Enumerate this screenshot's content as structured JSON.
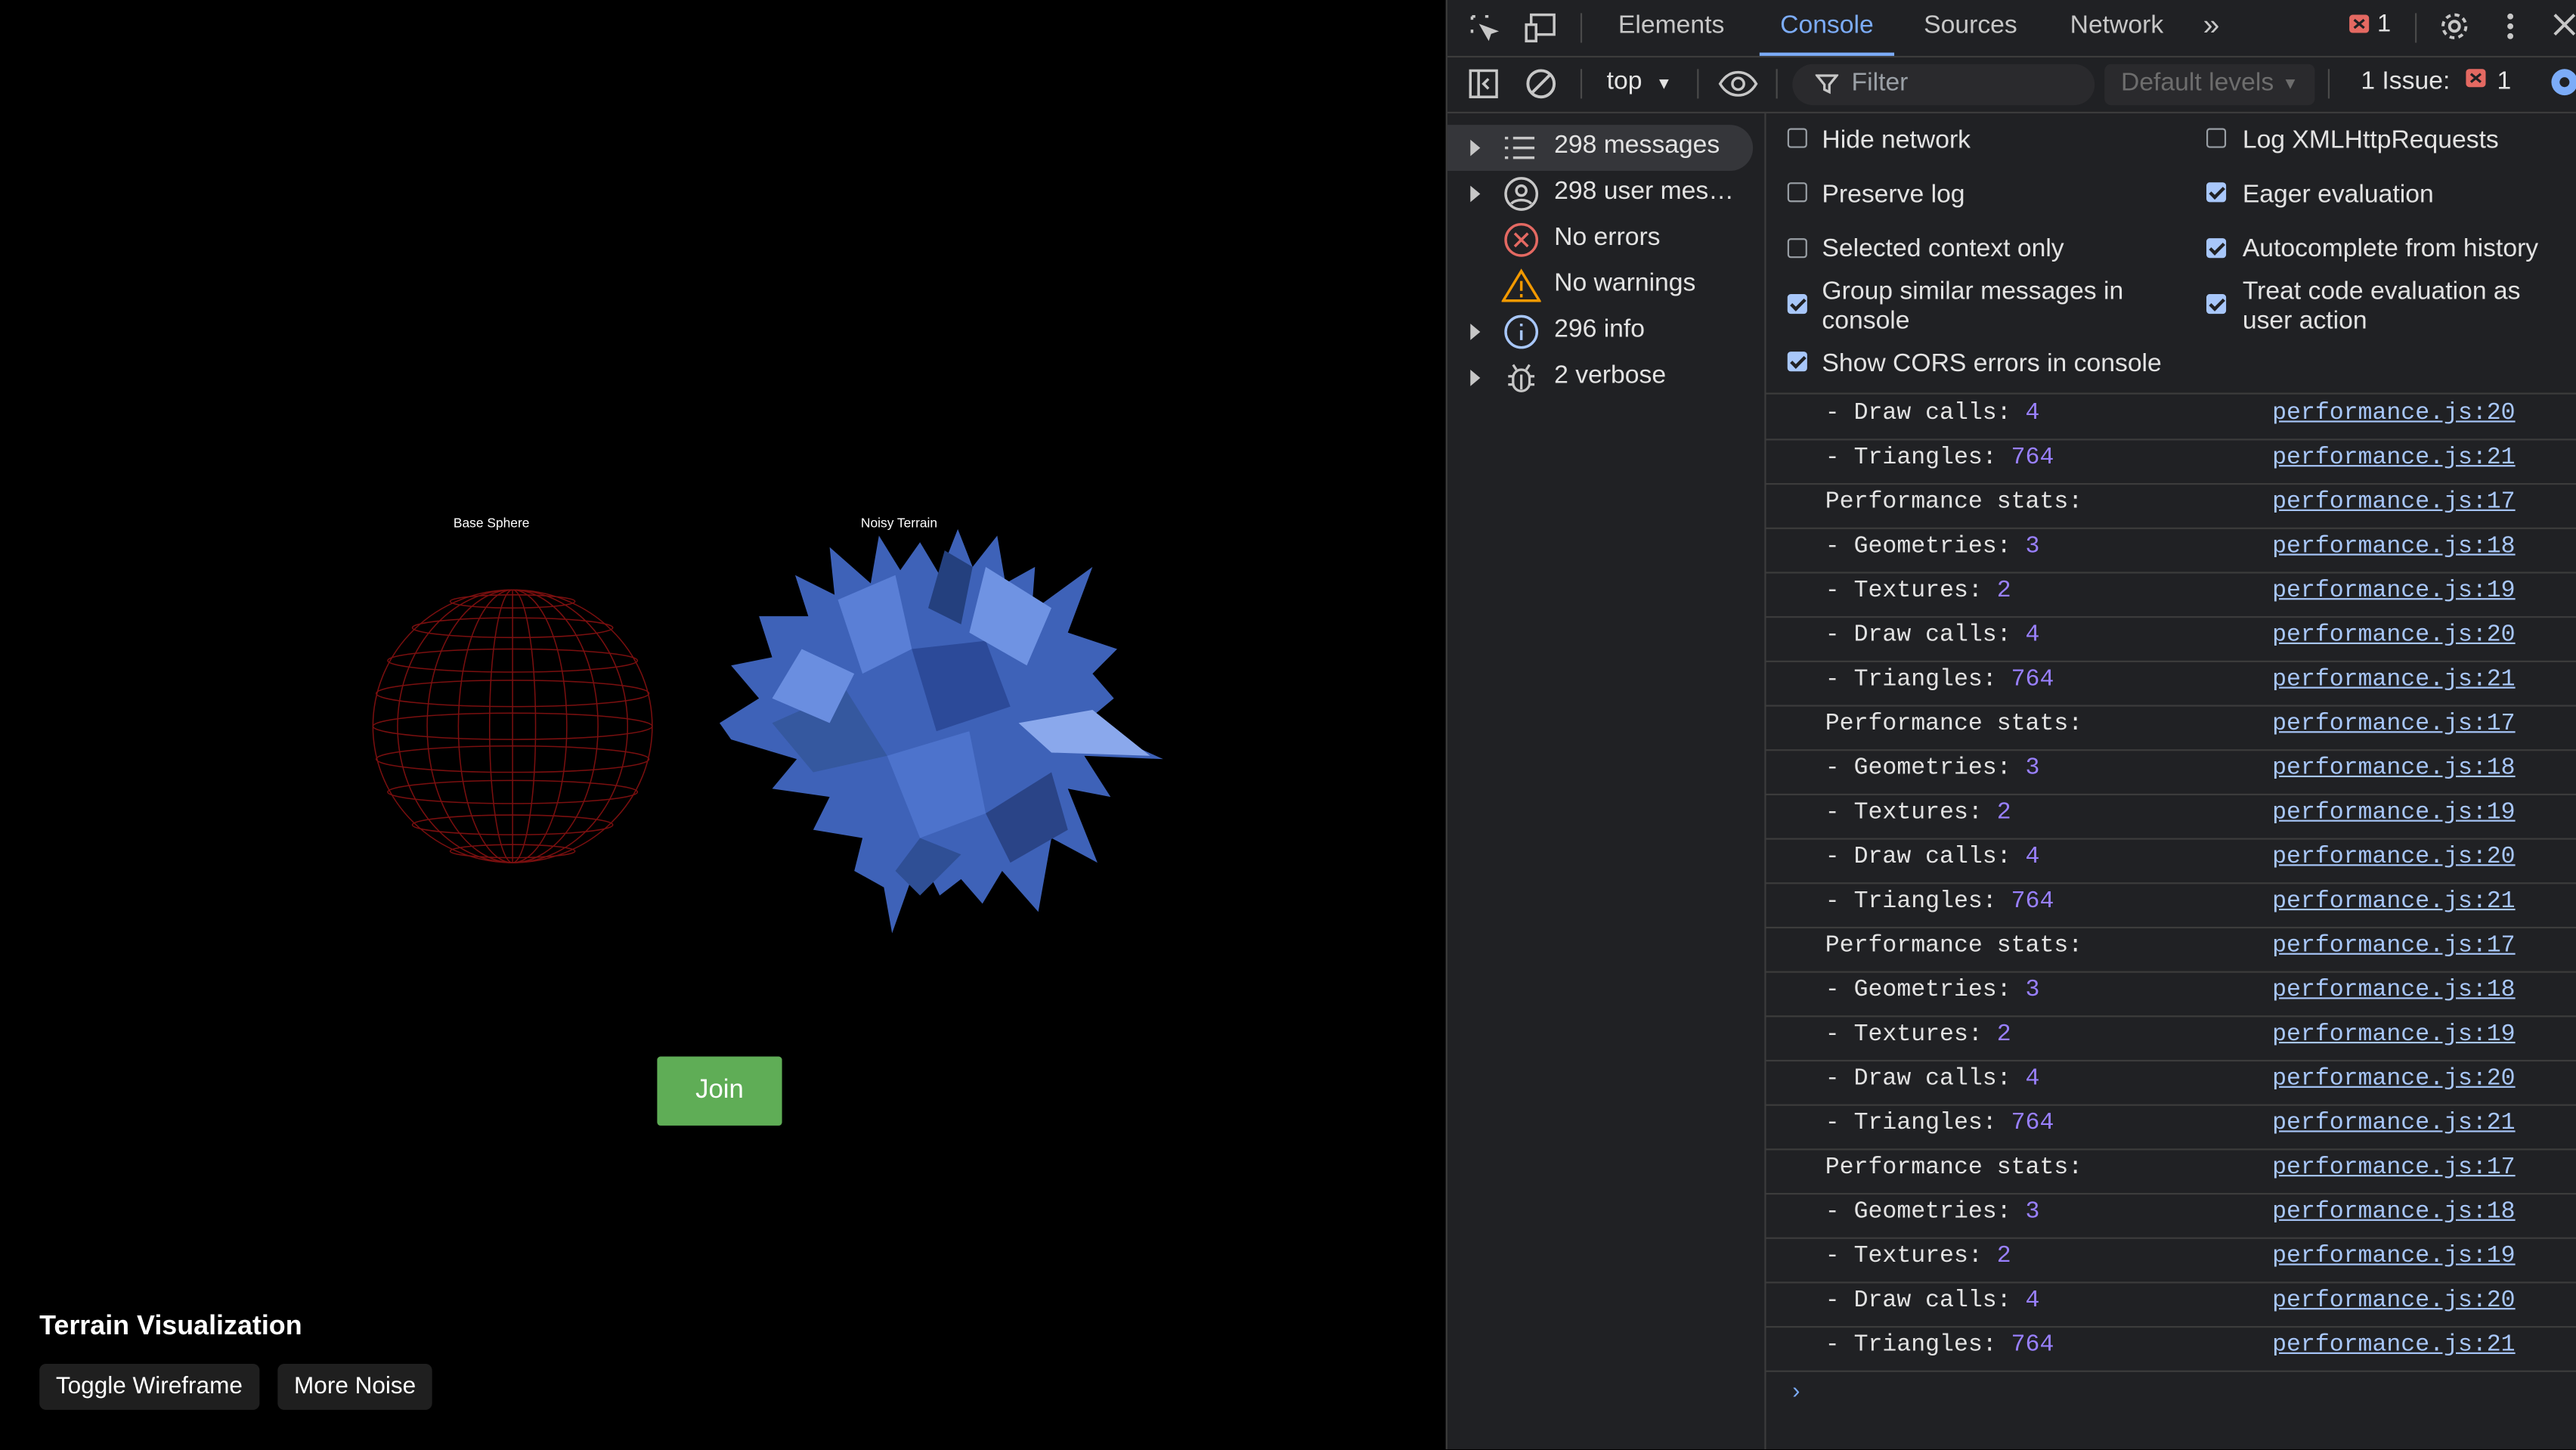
{
  "page": {
    "labels": {
      "sphere": "Base Sphere",
      "terrain": "Noisy Terrain"
    },
    "join_label": "Join",
    "title": "Terrain Visualization",
    "buttons": {
      "wireframe": "Toggle Wireframe",
      "noise": "More Noise"
    }
  },
  "devtools": {
    "tabs": [
      "Elements",
      "Console",
      "Sources",
      "Network"
    ],
    "active_tab": "Console",
    "error_badge_count": "1",
    "context": "top",
    "filter_placeholder": "Filter",
    "levels": "Default levels",
    "issues_label": "1 Issue:",
    "issues_count": "1",
    "sidebar": [
      {
        "label": "298 messages",
        "icon": "list-icon",
        "expandable": true,
        "selected": true
      },
      {
        "label": "298 user mes…",
        "icon": "user-icon",
        "expandable": true
      },
      {
        "label": "No errors",
        "icon": "error-icon",
        "expandable": false
      },
      {
        "label": "No warnings",
        "icon": "warning-icon",
        "expandable": false
      },
      {
        "label": "296 info",
        "icon": "info-icon",
        "expandable": true
      },
      {
        "label": "2 verbose",
        "icon": "bug-icon",
        "expandable": true
      }
    ],
    "settings": {
      "hide_network": {
        "label": "Hide network",
        "checked": false
      },
      "log_xhr": {
        "label": "Log XMLHttpRequests",
        "checked": false
      },
      "preserve_log": {
        "label": "Preserve log",
        "checked": false
      },
      "eager_eval": {
        "label": "Eager evaluation",
        "checked": true
      },
      "selected_context": {
        "label": "Selected context only",
        "checked": false
      },
      "autocomplete": {
        "label": "Autocomplete from history",
        "checked": true
      },
      "group_similar": {
        "label": "Group similar messages in console",
        "checked": true
      },
      "treat_code": {
        "label": "Treat code evaluation as user action",
        "checked": true
      },
      "cors_errors": {
        "label": "Show CORS errors in console",
        "checked": true
      }
    },
    "logs": [
      {
        "text": "- Draw calls: ",
        "value": "4",
        "source": "performance.js:20"
      },
      {
        "text": "- Triangles: ",
        "value": "764",
        "source": "performance.js:21"
      },
      {
        "text": "Performance stats:",
        "value": "",
        "source": "performance.js:17"
      },
      {
        "text": "- Geometries: ",
        "value": "3",
        "source": "performance.js:18"
      },
      {
        "text": "- Textures: ",
        "value": "2",
        "source": "performance.js:19"
      },
      {
        "text": "- Draw calls: ",
        "value": "4",
        "source": "performance.js:20"
      },
      {
        "text": "- Triangles: ",
        "value": "764",
        "source": "performance.js:21"
      },
      {
        "text": "Performance stats:",
        "value": "",
        "source": "performance.js:17"
      },
      {
        "text": "- Geometries: ",
        "value": "3",
        "source": "performance.js:18"
      },
      {
        "text": "- Textures: ",
        "value": "2",
        "source": "performance.js:19"
      },
      {
        "text": "- Draw calls: ",
        "value": "4",
        "source": "performance.js:20"
      },
      {
        "text": "- Triangles: ",
        "value": "764",
        "source": "performance.js:21"
      },
      {
        "text": "Performance stats:",
        "value": "",
        "source": "performance.js:17"
      },
      {
        "text": "- Geometries: ",
        "value": "3",
        "source": "performance.js:18"
      },
      {
        "text": "- Textures: ",
        "value": "2",
        "source": "performance.js:19"
      },
      {
        "text": "- Draw calls: ",
        "value": "4",
        "source": "performance.js:20"
      },
      {
        "text": "- Triangles: ",
        "value": "764",
        "source": "performance.js:21"
      },
      {
        "text": "Performance stats:",
        "value": "",
        "source": "performance.js:17"
      },
      {
        "text": "- Geometries: ",
        "value": "3",
        "source": "performance.js:18"
      },
      {
        "text": "- Textures: ",
        "value": "2",
        "source": "performance.js:19"
      },
      {
        "text": "- Draw calls: ",
        "value": "4",
        "source": "performance.js:20"
      },
      {
        "text": "- Triangles: ",
        "value": "764",
        "source": "performance.js:21"
      }
    ],
    "colors": {
      "accent": "#7cacf8",
      "link": "#a8c7fa",
      "number": "#9980ff",
      "error": "#e46962",
      "warning": "#f29900"
    }
  }
}
